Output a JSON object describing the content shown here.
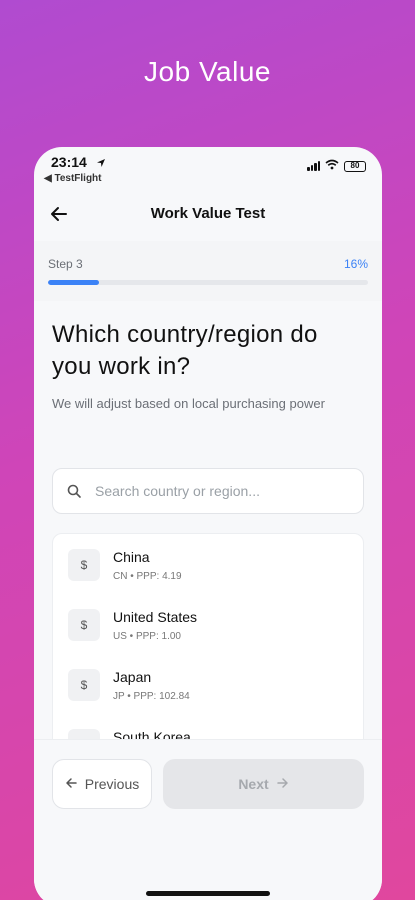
{
  "hero": {
    "title": "Job Value"
  },
  "status_bar": {
    "time": "23:14",
    "back_app": "◀ TestFlight",
    "battery": "80"
  },
  "nav": {
    "title": "Work Value Test"
  },
  "progress": {
    "step_label": "Step 3",
    "percent_label": "16%",
    "fraction": 0.16
  },
  "question": {
    "title": "Which country/region do you work in?",
    "subtitle": "We will adjust based on local purchasing power"
  },
  "search": {
    "placeholder": "Search country or region...",
    "value": ""
  },
  "countries": [
    {
      "symbol": "$",
      "name": "China",
      "meta": "CN • PPP: 4.19"
    },
    {
      "symbol": "$",
      "name": "United States",
      "meta": "US • PPP: 1.00"
    },
    {
      "symbol": "$",
      "name": "Japan",
      "meta": "JP • PPP: 102.84"
    },
    {
      "symbol": "$",
      "name": "South Korea",
      "meta": ""
    }
  ],
  "footer": {
    "previous_label": "Previous",
    "next_label": "Next"
  },
  "colors": {
    "accent": "#3b82f6",
    "gradient_start": "#b04bd0",
    "gradient_end": "#e0479e"
  },
  "icons": [
    "location-arrow-icon",
    "signal-icon",
    "wifi-icon",
    "battery-icon",
    "back-arrow-icon",
    "search-icon",
    "arrow-left-icon",
    "arrow-right-icon"
  ]
}
